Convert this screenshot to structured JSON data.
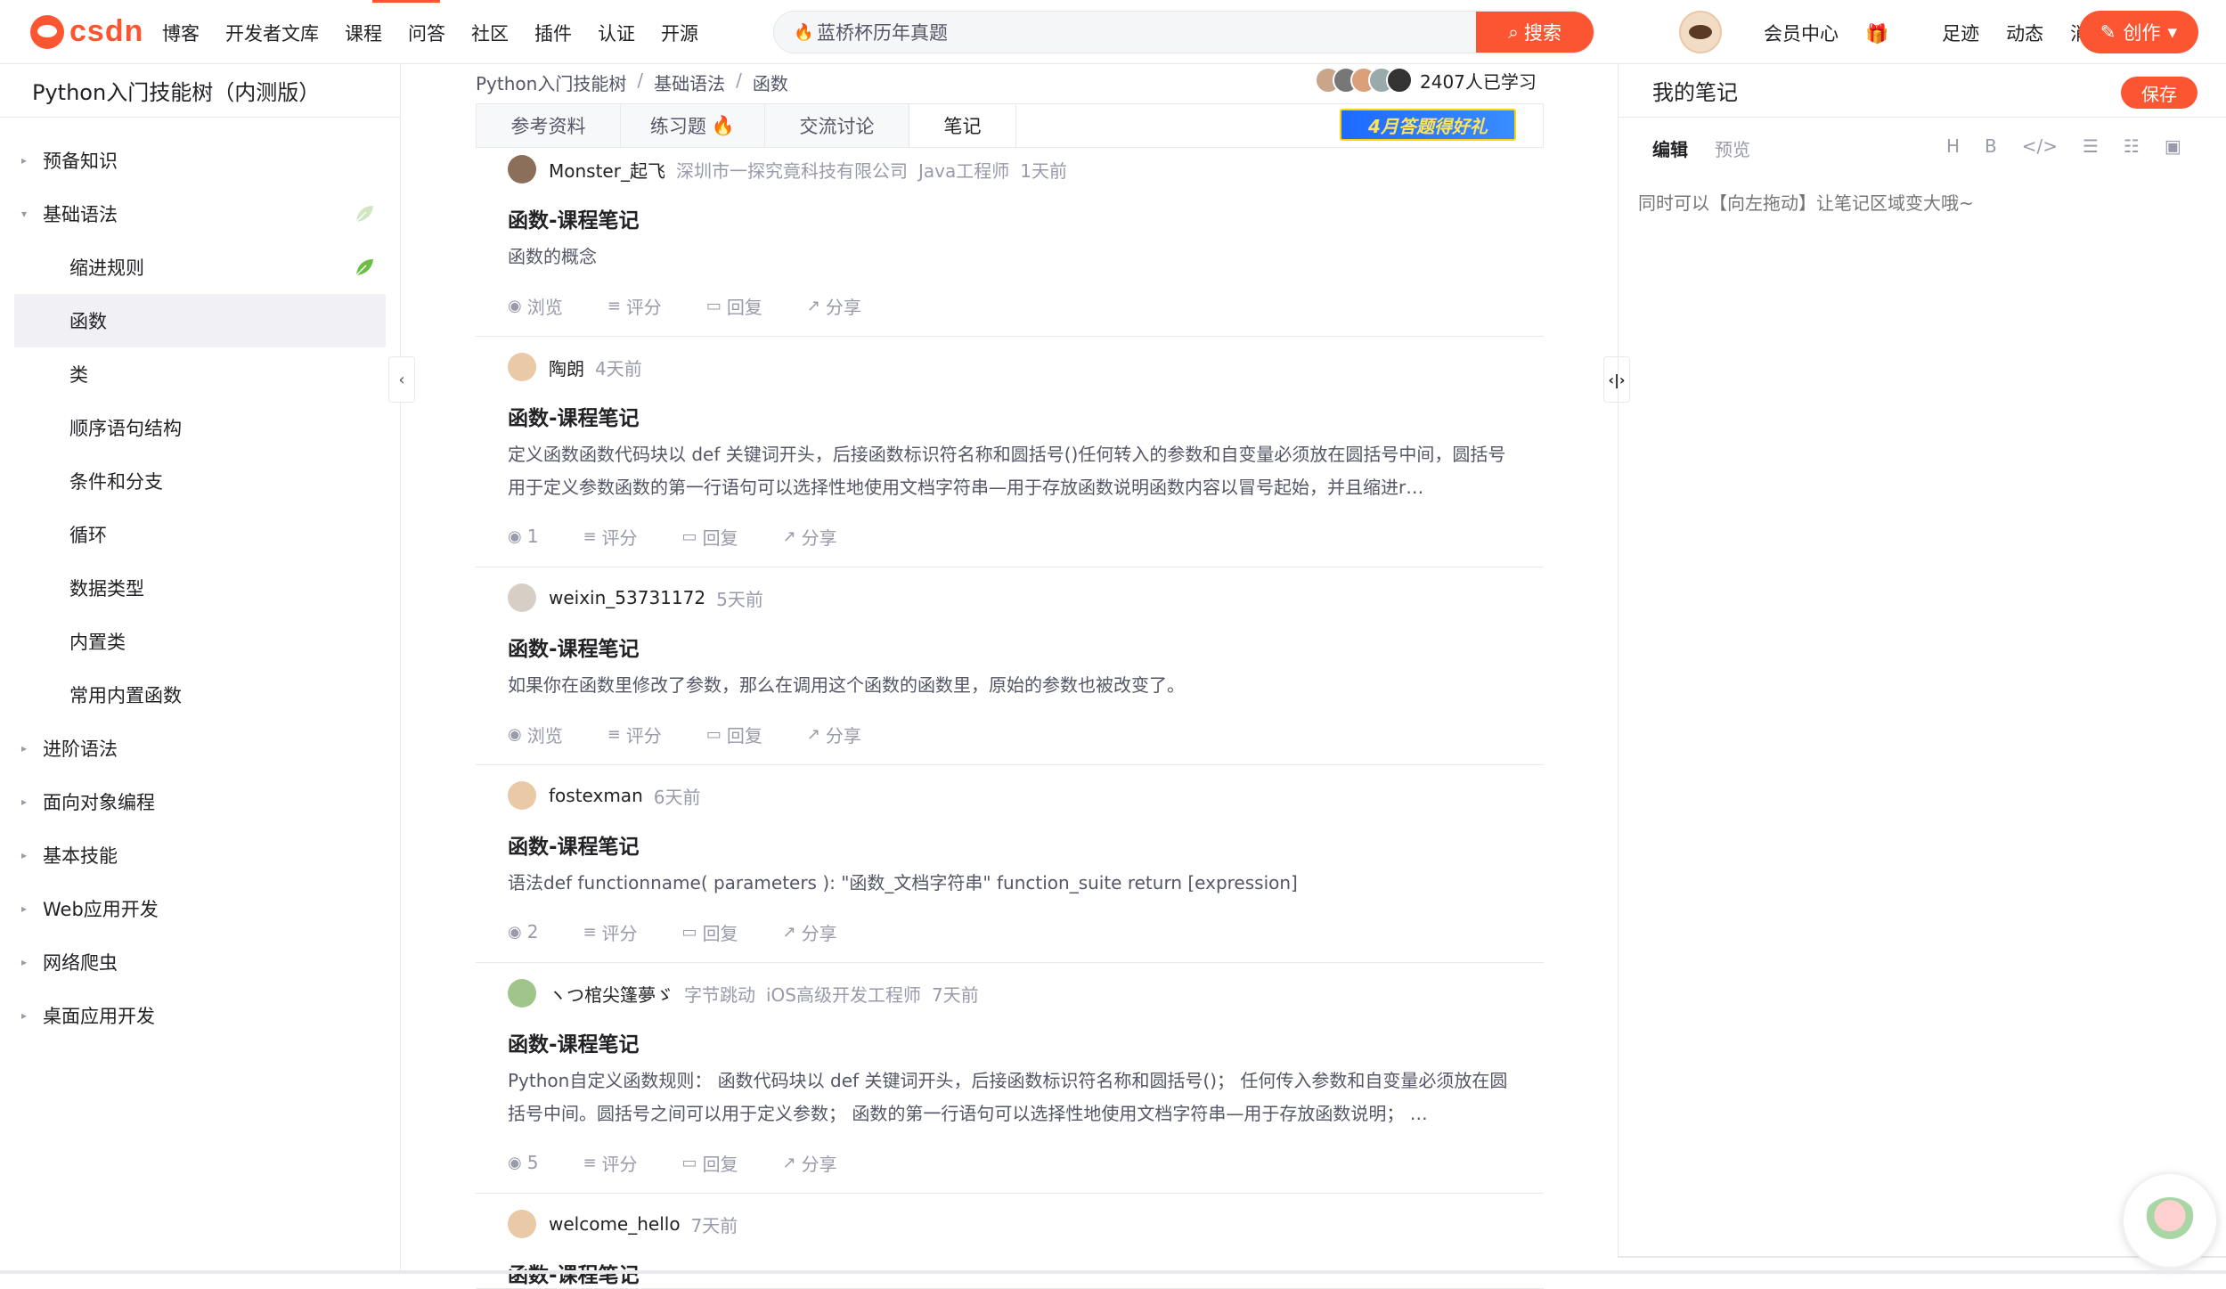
{
  "header": {
    "logo_text": "csdn",
    "nav": [
      "博客",
      "开发者文库",
      "课程",
      "问答",
      "社区",
      "插件",
      "认证",
      "开源"
    ],
    "search_value": "蓝桥杯历年真题",
    "search_button": "搜索",
    "right_links": [
      "会员中心",
      "足迹",
      "动态",
      "消息"
    ],
    "create_button": "创作"
  },
  "sidebar": {
    "title": "Python入门技能树（内测版）",
    "items": [
      {
        "label": "预备知识",
        "level": 0,
        "caret": "▸"
      },
      {
        "label": "基础语法",
        "level": 0,
        "caret": "▾",
        "leaf": "faded"
      },
      {
        "label": "缩进规则",
        "level": 1,
        "leaf": "green"
      },
      {
        "label": "函数",
        "level": 1,
        "active": true
      },
      {
        "label": "类",
        "level": 1
      },
      {
        "label": "顺序语句结构",
        "level": 1
      },
      {
        "label": "条件和分支",
        "level": 1
      },
      {
        "label": "循环",
        "level": 1
      },
      {
        "label": "数据类型",
        "level": 1
      },
      {
        "label": "内置类",
        "level": 1
      },
      {
        "label": "常用内置函数",
        "level": 1
      },
      {
        "label": "进阶语法",
        "level": 0,
        "caret": "▸"
      },
      {
        "label": "面向对象编程",
        "level": 0,
        "caret": "▸"
      },
      {
        "label": "基本技能",
        "level": 0,
        "caret": "▸"
      },
      {
        "label": "Web应用开发",
        "level": 0,
        "caret": "▸"
      },
      {
        "label": "网络爬虫",
        "level": 0,
        "caret": "▸"
      },
      {
        "label": "桌面应用开发",
        "level": 0,
        "caret": "▸"
      }
    ]
  },
  "main": {
    "breadcrumb": [
      "Python入门技能树",
      "基础语法",
      "函数"
    ],
    "learners_text": "2407人已学习",
    "tabs": [
      "参考资料",
      "练习题",
      "交流讨论",
      "笔记"
    ],
    "promo_text": "4月答题得好礼",
    "notes": [
      {
        "user": "Monster_起飞",
        "meta": [
          "深圳市一探究竟科技有限公司",
          "Java工程师",
          "1天前"
        ],
        "title": "函数-课程笔记",
        "body": "函数的概念",
        "lines": 1,
        "views": "浏览",
        "rate": "评分",
        "reply": "回复",
        "share": "分享",
        "avatar": "#8b6f5a"
      },
      {
        "user": "陶朗",
        "meta": [
          "4天前"
        ],
        "title": "函数-课程笔记",
        "body": "定义函数函数代码块以 def 关键词开头，后接函数标识符名称和圆括号()任何转入的参数和自变量必须放在圆括号中间，圆括号用于定义参数函数的第一行语句可以选择性地使用文档字符串—用于存放函数说明函数内容以冒号起始，并且缩进r…",
        "lines": 2,
        "views": "1",
        "rate": "评分",
        "reply": "回复",
        "share": "分享",
        "avatar": "#e9c9a6"
      },
      {
        "user": "weixin_53731172",
        "meta": [
          "5天前"
        ],
        "title": "函数-课程笔记",
        "body": "如果你在函数里修改了参数，那么在调用这个函数的函数里，原始的参数也被改变了。",
        "lines": 1,
        "views": "浏览",
        "rate": "评分",
        "reply": "回复",
        "share": "分享",
        "avatar": "#d7cfc6"
      },
      {
        "user": "fostexman",
        "meta": [
          "6天前"
        ],
        "title": "函数-课程笔记",
        "body": "语法def functionname( parameters ): \"函数_文档字符串\" function_suite return [expression]",
        "lines": 1,
        "views": "2",
        "rate": "评分",
        "reply": "回复",
        "share": "分享",
        "avatar": "#e9c9a6"
      },
      {
        "user": "ヽつ棺尖篷夢ゞ",
        "meta": [
          "字节跳动",
          "iOS高级开发工程师",
          "7天前"
        ],
        "title": "函数-课程笔记",
        "body": "Python自定义函数规则： 函数代码块以 def 关键词开头，后接函数标识符名称和圆括号()； 任何传入参数和自变量必须放在圆括号中间。圆括号之间可以用于定义参数； 函数的第一行语句可以选择性地使用文档字符串—用于存放函数说明； …",
        "lines": 2,
        "views": "5",
        "rate": "评分",
        "reply": "回复",
        "share": "分享",
        "avatar": "#9fc58a"
      },
      {
        "user": "welcome_hello",
        "meta": [
          "7天前"
        ],
        "title": "函数-课程笔记",
        "body": "",
        "lines": 0,
        "views": "",
        "rate": "",
        "reply": "",
        "share": "",
        "avatar": "#e9c9a6"
      }
    ]
  },
  "notes_panel": {
    "title": "我的笔记",
    "save_button": "保存",
    "tab_edit": "编辑",
    "tab_preview": "预览",
    "tools": [
      "H",
      "B",
      "</>",
      "☰",
      "☷",
      "▣"
    ],
    "placeholder": "同时可以【向左拖动】让笔记区域变大哦~"
  },
  "colors": {
    "accent": "#fc5531",
    "text": "#222226",
    "muted": "#999aaa"
  }
}
